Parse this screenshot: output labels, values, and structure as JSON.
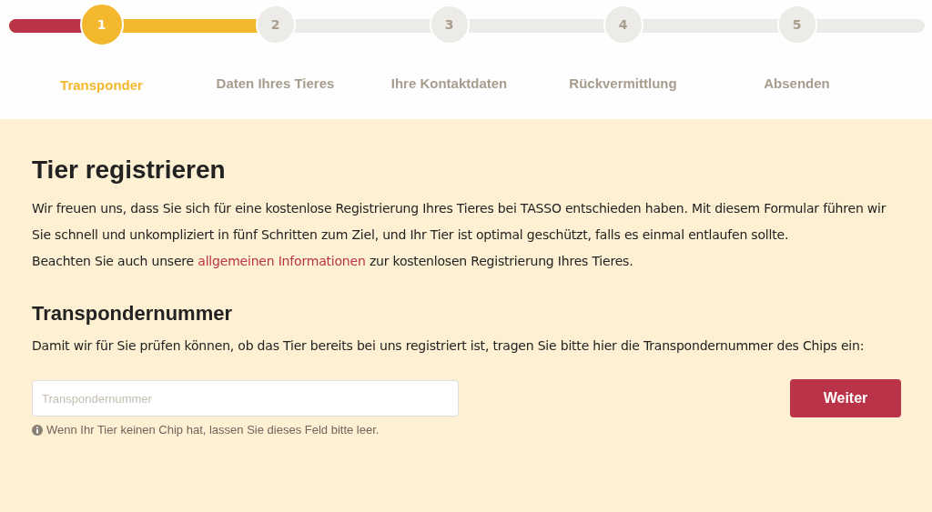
{
  "steps": [
    {
      "number": "1",
      "label": "Transponder",
      "selected": true
    },
    {
      "number": "2",
      "label": "Daten Ihres Tieres",
      "selected": false
    },
    {
      "number": "3",
      "label": "Ihre Kontaktdaten",
      "selected": false
    },
    {
      "number": "4",
      "label": "Rückvermittlung",
      "selected": false
    },
    {
      "number": "5",
      "label": "Absenden",
      "selected": false
    }
  ],
  "title": "Tier registrieren",
  "intro": [
    "Wir freuen uns, dass Sie sich für eine kostenlose Registrierung Ihres Tieres bei TASSO entschieden haben. Mit diesem Formular führen wir Sie schnell und unkompliziert in fünf Schritten zum Ziel, und Ihr Tier ist optimal geschützt, falls es einmal entlaufen sollte."
  ],
  "note": {
    "before": "Beachten Sie auch unsere",
    "link": "allgemeinen Informationen",
    "after": "zur kostenlosen Registrierung Ihres Tieres."
  },
  "section_title": "Transpondernummer",
  "section_text": "Damit wir für Sie prüfen können, ob das Tier bereits bei uns registriert ist, tragen Sie bitte hier die Transpondernummer des Chips ein:",
  "field": {
    "placeholder": "Transpondernummer"
  },
  "button": "Weiter",
  "hint": "Wenn Ihr Tier keinen Chip hat, lassen Sie dieses Feld bitte leer."
}
